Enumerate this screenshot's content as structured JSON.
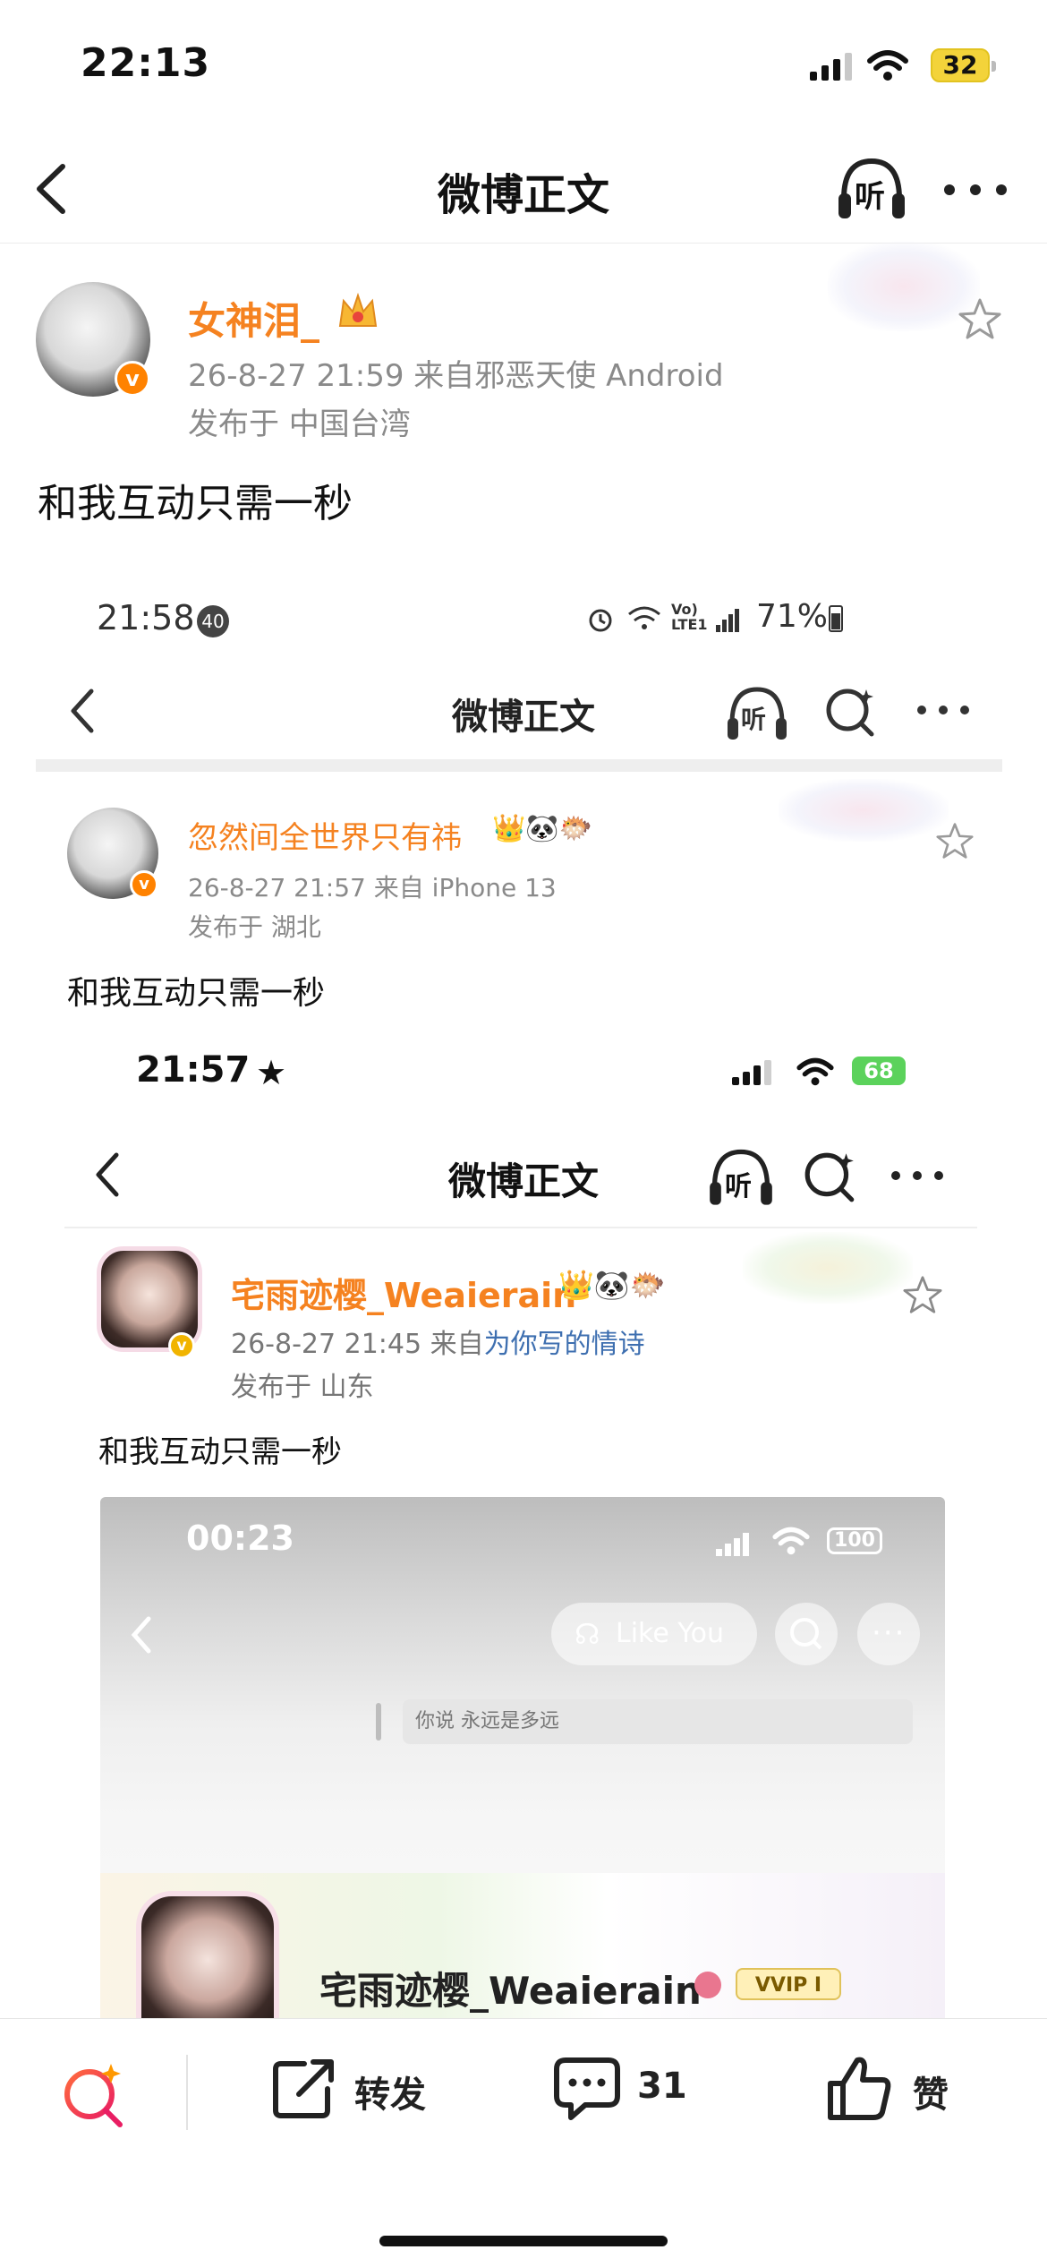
{
  "status_bar": {
    "time": "22:13",
    "battery": "32"
  },
  "nav": {
    "title": "微博正文",
    "listen_label": "听"
  },
  "post": {
    "username": "女神泪_",
    "meta_line1": "26-8-27 21:59  来自邪恶天使 Android",
    "meta_line2": "发布于 中国台湾",
    "text": "和我互动只需一秒"
  },
  "nested1": {
    "time": "21:58",
    "notif_count": "40",
    "status_right": "71%",
    "nav_title": "微博正文",
    "listen_label": "听",
    "username": "忽然间全世界只有祎",
    "meta_line1": "26-8-27 21:57  来自 iPhone 13",
    "meta_line2": "发布于 湖北",
    "text": "和我互动只需一秒"
  },
  "nested2": {
    "time": "21:57",
    "battery": "68",
    "nav_title": "微博正文",
    "listen_label": "听",
    "username": "宅雨迹樱_Weaierain",
    "meta_prefix": "26-8-27 21:45  来自",
    "meta_source": "为你写的情诗",
    "meta_line2": "发布于 山东",
    "text": "和我互动只需一秒"
  },
  "video": {
    "time": "00:23",
    "battery": "100",
    "pill_label": "Like You",
    "search_text": "你说  永远是多远",
    "name": "宅雨迹樱_Weaierain",
    "vip_label": "VVIP I"
  },
  "toolbar": {
    "repost_label": "转发",
    "comment_count": "31",
    "like_label": "赞"
  },
  "colors": {
    "accent_orange": "#f58220",
    "vip_badge": "#ff8200"
  }
}
